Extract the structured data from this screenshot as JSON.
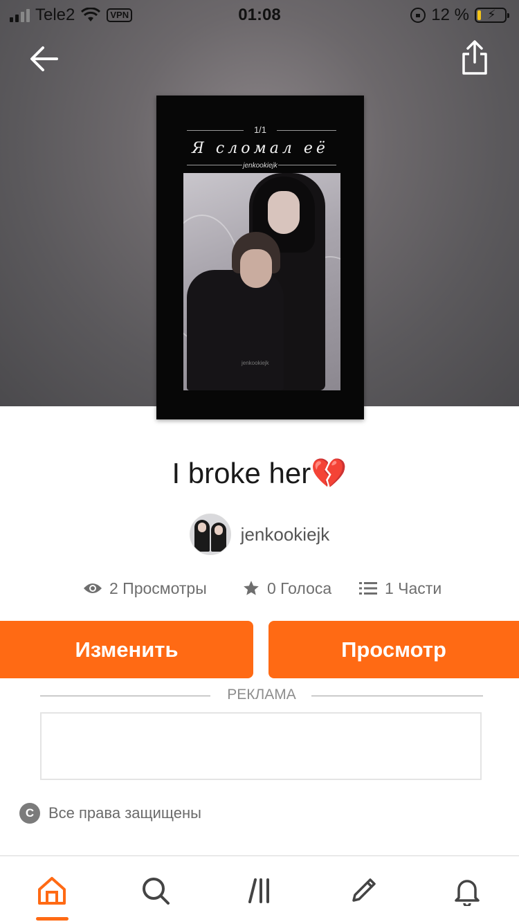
{
  "status_bar": {
    "carrier": "Tele2",
    "vpn": "VPN",
    "time": "01:08",
    "battery_percent": "12 %",
    "battery_level": 0.12
  },
  "header": {
    "back_icon": "arrow-left-icon",
    "share_icon": "share-icon"
  },
  "cover": {
    "part_label": "1/1",
    "title": "Я сломал её",
    "author": "jenkookiejk",
    "watermark": "jenkookiejk"
  },
  "story": {
    "title": "I broke her💔",
    "author": "jenkookiejk"
  },
  "stats": {
    "views": "2 Просмотры",
    "votes": "0 Голоса",
    "parts": "1 Части",
    "views_icon": "eye-icon",
    "votes_icon": "star-icon",
    "parts_icon": "list-icon"
  },
  "actions": {
    "edit": "Изменить",
    "view": "Просмотр",
    "accent": "#ff6a14"
  },
  "ad": {
    "label": "РЕКЛАМА"
  },
  "footer": {
    "rights": "Все права защищены",
    "rights_icon": "copyright-icon"
  },
  "bottom_nav": {
    "items": [
      {
        "icon": "home-icon",
        "active": true
      },
      {
        "icon": "search-icon",
        "active": false
      },
      {
        "icon": "library-icon",
        "active": false
      },
      {
        "icon": "pencil-icon",
        "active": false
      },
      {
        "icon": "bell-icon",
        "active": false
      }
    ]
  }
}
